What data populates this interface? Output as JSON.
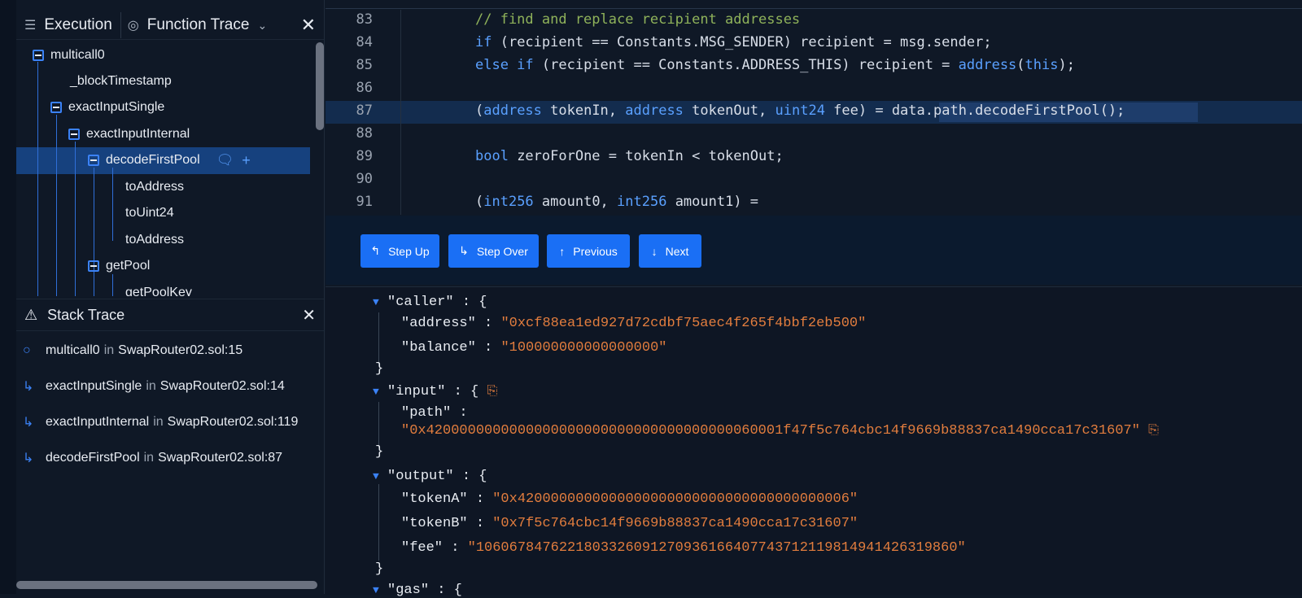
{
  "tabs": {
    "execution": "Execution",
    "function_trace": "Function Trace",
    "close": "✕"
  },
  "tree": [
    {
      "label": "multicall0"
    },
    {
      "label": "_blockTimestamp"
    },
    {
      "label": "exactInputSingle"
    },
    {
      "label": "exactInputInternal"
    },
    {
      "label": "decodeFirstPool"
    },
    {
      "label": "toAddress"
    },
    {
      "label": "toUint24"
    },
    {
      "label": "toAddress"
    },
    {
      "label": "getPool"
    },
    {
      "label": "getPoolKey"
    }
  ],
  "stack": {
    "title": "Stack Trace",
    "in": "in",
    "items": [
      {
        "name": "multicall0",
        "loc": "SwapRouter02.sol:15"
      },
      {
        "name": "exactInputSingle",
        "loc": "SwapRouter02.sol:14"
      },
      {
        "name": "exactInputInternal",
        "loc": "SwapRouter02.sol:119"
      },
      {
        "name": "decodeFirstPool",
        "loc": "SwapRouter02.sol:87"
      }
    ]
  },
  "code": {
    "line_numbers": [
      "83",
      "84",
      "85",
      "86",
      "87",
      "88",
      "89",
      "90",
      "91"
    ],
    "l83": "// find and replace recipient addresses",
    "l84a": "if",
    "l84b": " (recipient == Constants.MSG_SENDER) recipient = msg.sender;",
    "l85a": "else if",
    "l85b": " (recipient == Constants.ADDRESS_THIS) recipient = ",
    "l85c": "address",
    "l85d": "(",
    "l85e": "this",
    "l85f": ");",
    "l87a": "(",
    "l87b": "address",
    "l87c": " tokenIn, ",
    "l87d": "address",
    "l87e": " tokenOut, ",
    "l87f": "uint24",
    "l87g": " fee) = data.path.decodeFirstPool();",
    "l89a": "bool",
    "l89b": " zeroForOne = tokenIn < tokenOut;",
    "l91a": "(",
    "l91b": "int256",
    "l91c": " amount0, ",
    "l91d": "int256",
    "l91e": " amount1) ="
  },
  "toolbar": {
    "step_up": "Step Up",
    "step_over": "Step Over",
    "previous": "Previous",
    "next": "Next"
  },
  "json": {
    "caller_key": "\"caller\"",
    "address_key": "\"address\"",
    "address_val": "\"0xcf88ea1ed927d72cdbf75aec4f265f4bbf2eb500\"",
    "balance_key": "\"balance\"",
    "balance_val": "\"100000000000000000\"",
    "input_key": "\"input\"",
    "path_key": "\"path\"",
    "path_val": "\"0x4200000000000000000000000000000000000060001f47f5c764cbc14f9669b88837ca1490cca17c31607\"",
    "output_key": "\"output\"",
    "tokenA_key": "\"tokenA\"",
    "tokenA_val": "\"0x4200000000000000000000000000000000000006\"",
    "tokenB_key": "\"tokenB\"",
    "tokenB_val": "\"0x7f5c764cbc14f9669b88837ca1490cca17c31607\"",
    "fee_key": "\"fee\"",
    "fee_val": "\"1060678476221803326091270936166407743712119814941426319860\"",
    "gas_key": "\"gas\""
  },
  "colors": {
    "accent": "#1a6ff5",
    "selected_row": "#16417e",
    "string": "#e27d3e",
    "keyword": "#5aa0ff",
    "comment": "#8fb25a"
  }
}
